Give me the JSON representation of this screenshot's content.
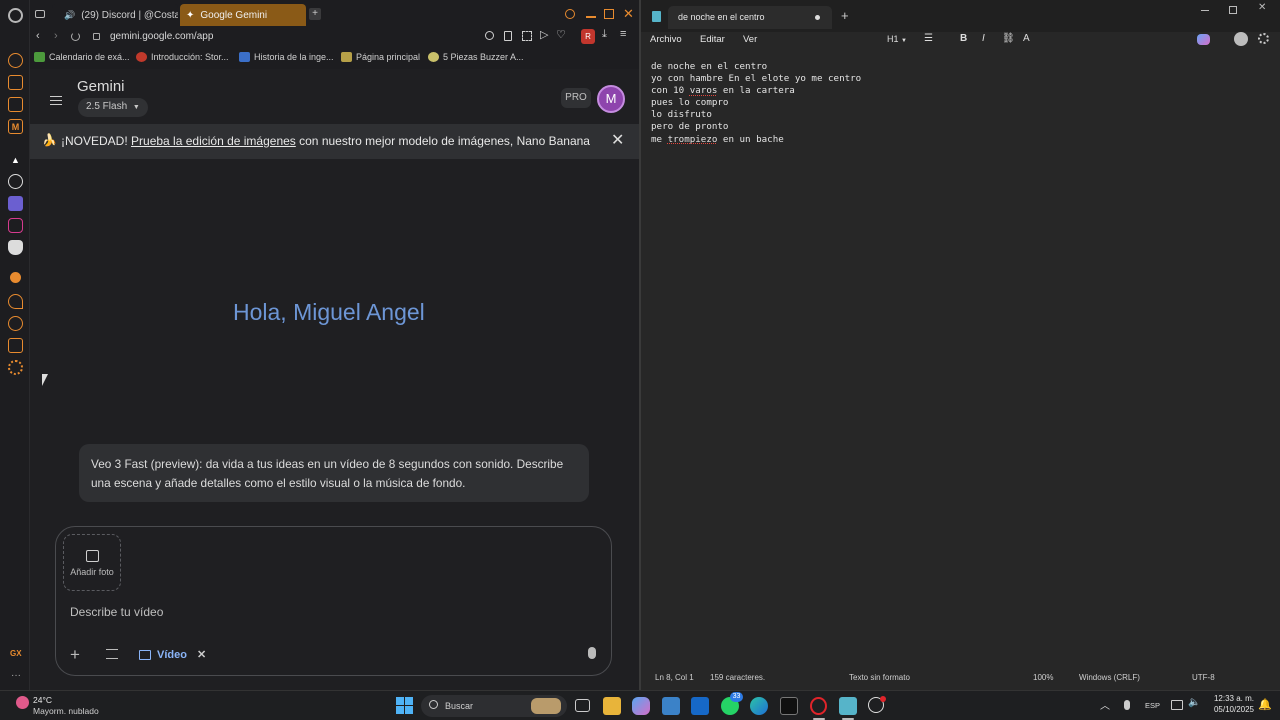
{
  "browser": {
    "tabs": [
      {
        "label": "(29) Discord | @Costa",
        "active": false
      },
      {
        "label": "Google Gemini",
        "active": true
      }
    ],
    "url": "gemini.google.com/app",
    "bookmarks": [
      {
        "label": "Calendario de exá..."
      },
      {
        "label": "Introducción: Stor..."
      },
      {
        "label": "Historia de la inge..."
      },
      {
        "label": "Página principal"
      },
      {
        "label": "5 Piezas Buzzer A..."
      }
    ],
    "extension_badge": "R",
    "sidebar_bottom_label": "GX"
  },
  "gemini": {
    "app_name": "Gemini",
    "model": "2.5 Flash",
    "pro_label": "PRO",
    "avatar_letter": "M",
    "banner": {
      "prefix": "¡NOVEDAD! ",
      "link": "Prueba la edición de imágenes",
      "suffix": " con nuestro mejor modelo de imágenes, Nano Banana"
    },
    "greeting": "Hola, Miguel Angel",
    "suggestion": "Veo 3 Fast (preview): da vida a tus ideas en un vídeo de 8 segundos con sonido. Describe una escena y añade detalles como el estilo visual o la música de fondo.",
    "composer": {
      "add_photo_label": "Añadir foto",
      "placeholder": "Describe tu vídeo",
      "video_chip": "Vídeo"
    }
  },
  "notepad": {
    "tab_title": "de noche en el centro",
    "menu": [
      "Archivo",
      "Editar",
      "Ver"
    ],
    "heading_selector": "H1",
    "lines": [
      "de noche en el centro",
      "yo con hambre En el elote yo me centro",
      "con 10 varos en la cartera",
      "pues lo compro",
      "lo disfruto",
      "pero de pronto",
      "me trompiezo en un bache"
    ],
    "status": {
      "position": "Ln 8, Col 1",
      "chars": "159 caracteres.",
      "format": "Texto sin formato",
      "zoom": "100%",
      "line_endings": "Windows (CRLF)",
      "encoding": "UTF-8"
    }
  },
  "taskbar": {
    "weather_temp": "24°C",
    "weather_desc": "Mayorm. nublado",
    "search_label": "Buscar",
    "whatsapp_badge": "33",
    "language": "ESP",
    "time": "12:33 a. m.",
    "date": "05/10/2025"
  },
  "colors": {
    "gemini_greeting": "#6d96d6",
    "accent_tab": "#8a5a17",
    "avatar": "#8e44ad",
    "opera_red": "#e0242a"
  }
}
